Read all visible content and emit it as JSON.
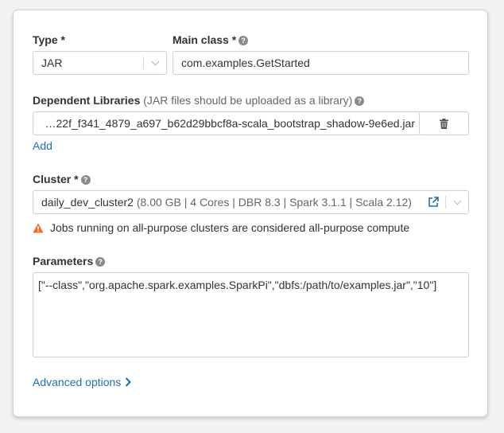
{
  "type": {
    "label": "Type *",
    "value": "JAR"
  },
  "main_class": {
    "label": "Main class *",
    "value": "com.examples.GetStarted"
  },
  "dependent_libraries": {
    "label": "Dependent Libraries",
    "hint": "(JAR files should be uploaded as a library)",
    "value": "…22f_f341_4879_a697_b62d29bbcf8a-scala_bootstrap_shadow-9e6ed.jar",
    "add_label": "Add"
  },
  "cluster": {
    "label": "Cluster *",
    "name": "daily_dev_cluster2",
    "details": "(8.00 GB | 4 Cores | DBR 8.3 | Spark 3.1.1 | Scala 2.12)",
    "warning": "Jobs running on all-purpose clusters are considered all-purpose compute"
  },
  "parameters": {
    "label": "Parameters",
    "value": "[\"--class\",\"org.apache.spark.examples.SparkPi\",\"dbfs:/path/to/examples.jar\",\"10\"]"
  },
  "advanced_options": {
    "label": "Advanced options"
  },
  "colors": {
    "link": "#1f6fb2",
    "warning": "#e8731a"
  }
}
